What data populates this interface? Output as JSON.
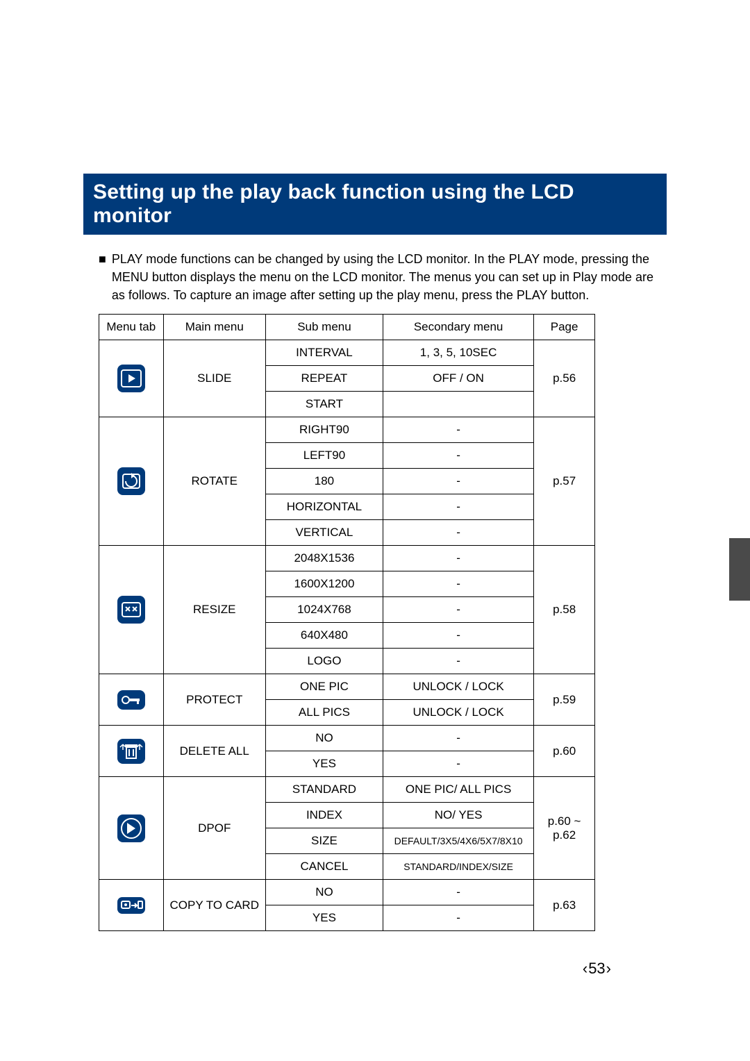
{
  "title": "Setting up the play back function using the LCD monitor",
  "intro": "PLAY mode functions can be changed by using the LCD monitor. In the PLAY mode, pressing the MENU button displays the menu on the LCD monitor. The menus you can set up in Play mode are as follows. To capture an image after setting up the play menu, press the PLAY button.",
  "headers": {
    "menu_tab": "Menu tab",
    "main_menu": "Main menu",
    "sub_menu": "Sub menu",
    "secondary_menu": "Secondary menu",
    "page": "Page"
  },
  "rows": {
    "slide": {
      "main": "SLIDE",
      "subs": [
        "INTERVAL",
        "REPEAT",
        "START"
      ],
      "secs": [
        "1, 3, 5, 10SEC",
        "OFF / ON",
        ""
      ],
      "page": "p.56"
    },
    "rotate": {
      "main": "ROTATE",
      "subs": [
        "RIGHT90",
        "LEFT90",
        "180",
        "HORIZONTAL",
        "VERTICAL"
      ],
      "secs": [
        "-",
        "-",
        "-",
        "-",
        "-"
      ],
      "page": "p.57"
    },
    "resize": {
      "main": "RESIZE",
      "subs": [
        "2048X1536",
        "1600X1200",
        "1024X768",
        "640X480",
        "LOGO"
      ],
      "secs": [
        "-",
        "-",
        "-",
        "-",
        "-"
      ],
      "page": "p.58"
    },
    "protect": {
      "main": "PROTECT",
      "subs": [
        "ONE PIC",
        "ALL PICS"
      ],
      "secs": [
        "UNLOCK / LOCK",
        "UNLOCK / LOCK"
      ],
      "page": "p.59"
    },
    "deleteall": {
      "main": "DELETE ALL",
      "subs": [
        "NO",
        "YES"
      ],
      "secs": [
        "-",
        "-"
      ],
      "page": "p.60"
    },
    "dpof": {
      "main": "DPOF",
      "subs": [
        "STANDARD",
        "INDEX",
        "SIZE",
        "CANCEL"
      ],
      "secs": [
        "ONE PIC/ ALL PICS",
        "NO/ YES",
        "DEFAULT/3X5/4X6/5X7/8X10",
        "STANDARD/INDEX/SIZE"
      ],
      "page": "p.60 ~ p.62"
    },
    "copy": {
      "main": "COPY TO CARD",
      "subs": [
        "NO",
        "YES"
      ],
      "secs": [
        "-",
        "-"
      ],
      "page": "p.63"
    }
  },
  "page_number": "53"
}
